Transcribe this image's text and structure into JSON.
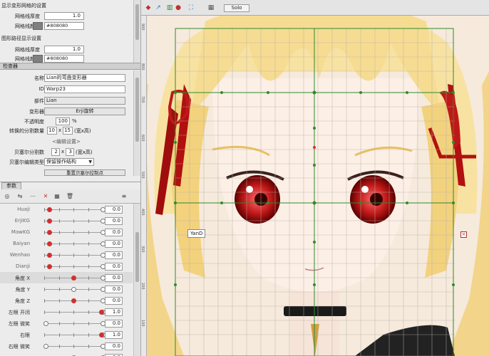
{
  "panel": {
    "sec1_title": "显示变形网格的设置",
    "sec1_line_width_label": "网格线厚度",
    "sec1_line_width": "1.0",
    "sec1_line_color_label": "网格线颜色",
    "sec1_line_color": "#808080",
    "sec2_title": "图形路径显示设置",
    "sec2_line_width_label": "网格线厚度",
    "sec2_line_width": "1.0",
    "sec2_line_color_label": "网格线颜色",
    "sec2_line_color": "#808080"
  },
  "inspector": {
    "header": "检查器",
    "name_label": "名称",
    "name_value": "Lian的弯曲变形器",
    "id_label": "ID",
    "id_value": "Warp23",
    "part_label": "部件",
    "part_value": "Lian",
    "deformer_label": "变形器",
    "deformer_value": "Erji旋转",
    "opacity_label": "不透明度",
    "opacity_value": "100",
    "opacity_unit": "%",
    "divisions_label": "转换的分割数量",
    "div_w": "10",
    "div_x": "x",
    "div_h": "15",
    "div_unit": "(宽x高)",
    "edit_settings": "<编辑设置>",
    "bezier_label": "贝塞尔分割数",
    "bez_w": "2",
    "bez_x": "x",
    "bez_h": "3",
    "bez_unit": "(宽x高)",
    "bezier_type_label": "贝塞尔编辑类型",
    "bezier_type_value": "保留操作结构",
    "restore_button": "重置贝塞尔控制点"
  },
  "params": {
    "tab_label": "参数",
    "rows": [
      {
        "label": "Huaji",
        "value": "0.0",
        "knob": 0.08,
        "knob_color": "red"
      },
      {
        "label": "ErjiKG",
        "value": "0.0",
        "knob": 0.08,
        "knob_color": "red"
      },
      {
        "label": "MawKG",
        "value": "0.0",
        "knob": 0.08,
        "knob_color": "red"
      },
      {
        "label": "Baiyan",
        "value": "0.0",
        "knob": 0.08,
        "knob_color": "red"
      },
      {
        "label": "Wenhao",
        "value": "0.0",
        "knob": 0.08,
        "knob_color": "red"
      },
      {
        "label": "Dianji",
        "value": "0.0",
        "knob": 0.08,
        "knob_color": "red"
      },
      {
        "label": "角度 X",
        "value": "0.0",
        "knob": 0.5,
        "knob_color": "red"
      },
      {
        "label": "角度 Y",
        "value": "0.0",
        "knob": 0.5,
        "knob_color": "white"
      },
      {
        "label": "角度 Z",
        "value": "0.0",
        "knob": 0.5,
        "knob_color": "red"
      },
      {
        "label": "左眼 开闭",
        "value": "1.0",
        "knob": 0.98,
        "knob_color": "red"
      },
      {
        "label": "左眼 微笑",
        "value": "0.0",
        "knob": 0.02,
        "knob_color": "white"
      },
      {
        "label": "右眼",
        "value": "1.0",
        "knob": 0.98,
        "knob_color": "red"
      },
      {
        "label": "右眼 微笑",
        "value": "0.0",
        "knob": 0.02,
        "knob_color": "white"
      },
      {
        "label": "",
        "value": "0.0",
        "knob": 0.5,
        "knob_color": "white"
      }
    ]
  },
  "canvas": {
    "solo_label": "Solo",
    "yand_label": "YanD",
    "ruler": [
      "900",
      "800",
      "700",
      "600",
      "500",
      "400",
      "300",
      "200",
      "100"
    ]
  }
}
